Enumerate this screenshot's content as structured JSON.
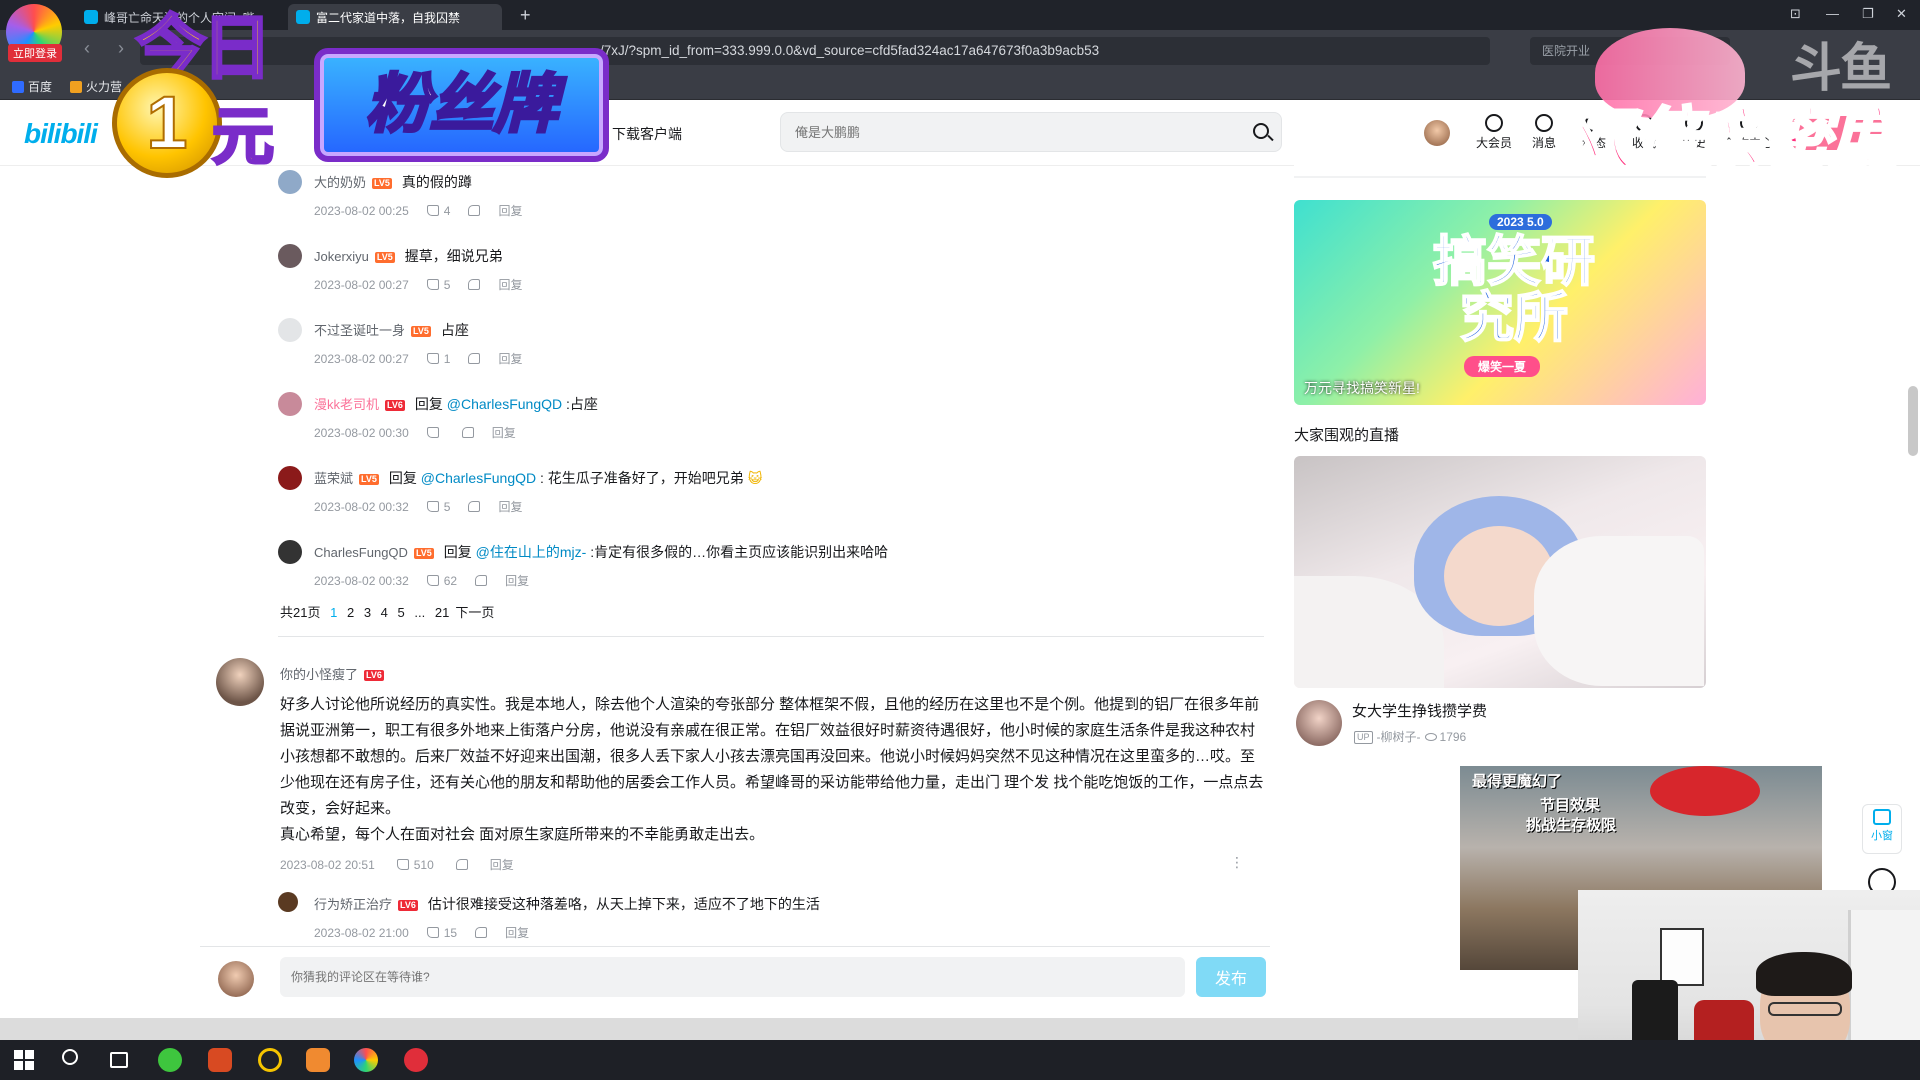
{
  "browser": {
    "tabs": [
      {
        "label": "峰哥亡命天涯的个人空间_哔"
      },
      {
        "label": "富二代家道中落，自我囚禁"
      }
    ],
    "url": "/7xJ/?spm_id_from=333.999.0.0&vd_source=cfd5fad324ac17a647673f0a3b9acb53",
    "extension_text": "医院开业",
    "bookmarks": [
      "百度",
      "火力营"
    ]
  },
  "overlays": {
    "login_badge": "立即登录",
    "promo_today": "今日",
    "promo_coin": "1",
    "promo_yuan": "元",
    "promo_badge": "粉丝牌",
    "double_text": "双倍亲密度",
    "watermark": "斗鱼"
  },
  "header": {
    "logo": "bilibili",
    "nav_client": "下载客户端",
    "search_placeholder": "俺是大鹏鹏",
    "items": [
      "大会员",
      "消息",
      "动态",
      "收藏",
      "历史",
      "创作中心"
    ]
  },
  "colors": {
    "brand_blue": "#00aeec",
    "brand_pink": "#fb7299",
    "level_badge": "#ff6d2e"
  },
  "comments": {
    "replies": [
      {
        "user": "大的奶奶",
        "level": "LV5",
        "text": "真的假的蹲",
        "date": "2023-08-02 00:25",
        "likes": "4",
        "reply_label": "回复"
      },
      {
        "user": "Jokerxiyu",
        "level": "LV5",
        "text": "握草，细说兄弟",
        "date": "2023-08-02 00:27",
        "likes": "5",
        "reply_label": "回复"
      },
      {
        "user": "不过圣诞吐一身",
        "level": "LV5",
        "text": "占座",
        "date": "2023-08-02 00:27",
        "likes": "1",
        "reply_label": "回复"
      },
      {
        "user": "漫kk老司机",
        "level": "LV6",
        "prefix": "回复",
        "mention": "@CharlesFungQD",
        "text": " :占座",
        "date": "2023-08-02 00:30",
        "likes": "",
        "reply_label": "回复"
      },
      {
        "user": "蓝荣斌",
        "level": "LV5",
        "prefix": "回复",
        "mention": "@CharlesFungQD",
        "text": " : 花生瓜子准备好了，开始吧兄弟",
        "date": "2023-08-02 00:32",
        "likes": "5",
        "reply_label": "回复"
      },
      {
        "user": "CharlesFungQD",
        "level": "LV5",
        "prefix": "回复",
        "mention": "@住在山上的mjz-",
        "text": " :肯定有很多假的…你看主页应该能识别出来哈哈",
        "date": "2023-08-02 00:32",
        "likes": "62",
        "reply_label": "回复"
      }
    ],
    "pager": {
      "total": "共21页",
      "pages": [
        "1",
        "2",
        "3",
        "4",
        "5",
        "...",
        "21"
      ],
      "next": "下一页"
    },
    "main": {
      "user": "你的小怪瘦了",
      "level": "LV6",
      "body": "好多人讨论他所说经历的真实性。我是本地人，除去他个人渲染的夸张部分 整体框架不假，且他的经历在这里也不是个例。他提到的铝厂在很多年前据说亚洲第一，职工有很多外地来上街落户分房，他说没有亲戚在很正常。在铝厂效益很好时薪资待遇很好，他小时候的家庭生活条件是我这种农村小孩想都不敢想的。后来厂效益不好迎来出国潮，很多人丢下家人小孩去漂亮国再没回来。他说小时候妈妈突然不见这种情况在这里蛮多的…哎。至少他现在还有房子住，还有关心他的朋友和帮助他的居委会工作人员。希望峰哥的采访能带给他力量，走出门 理个发 找个能吃饱饭的工作，一点点去改变，会好起来。",
      "body2": "真心希望，每个人在面对社会 面对原生家庭所带来的不幸能勇敢走出去。",
      "date": "2023-08-02 20:51",
      "likes": "510",
      "reply_label": "回复"
    },
    "main_reply": {
      "user": "行为矫正治疗",
      "level": "LV6",
      "text": "估计很难接受这种落差咯，从天上掉下来，适应不了地下的生活",
      "date": "2023-08-02 21:00",
      "likes": "15",
      "reply_label": "回复"
    }
  },
  "composer": {
    "placeholder": "你猜我的评论区在等待谁?",
    "post_label": "发布"
  },
  "sidebar": {
    "banner": {
      "year": "2023 5.0",
      "title": "搞笑研究所",
      "pill": "爆笑一夏",
      "caption": "万元寻找搞笑新星!"
    },
    "live_heading": "大家围观的直播",
    "live": {
      "title": "女大学生挣钱攒学费",
      "up_badge": "UP",
      "streamer": "-柳树子-",
      "viewers": "1796"
    },
    "video": {
      "line1": "最得更魔幻了",
      "line2": "节目效果",
      "line3": "挑战生存极限"
    },
    "float_label": "小窗"
  }
}
